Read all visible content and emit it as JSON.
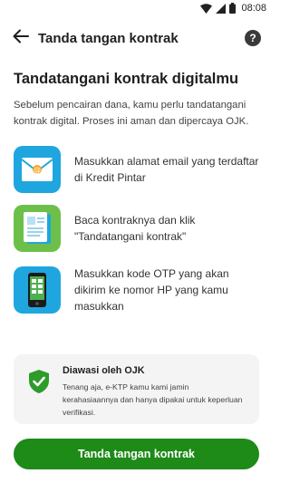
{
  "status_bar": {
    "time": "08:08"
  },
  "app_bar": {
    "title": "Tanda tangan kontrak",
    "help_label": "?"
  },
  "heading": "Tandatangani kontrak digitalmu",
  "intro": "Sebelum pencairan dana, kamu perlu tandatangani kontrak digital. Proses ini aman dan dipercaya OJK.",
  "steps": [
    {
      "icon": "email-envelope-icon",
      "text": "Masukkan alamat email yang terdaftar di Kredit Pintar"
    },
    {
      "icon": "document-icon",
      "text": "Baca kontraknya dan klik \"Tandatangani kontrak\""
    },
    {
      "icon": "phone-otp-icon",
      "text": "Masukkan kode OTP yang akan dikirim ke nomor HP yang kamu masukkan"
    }
  ],
  "ojk_card": {
    "title": "Diawasi oleh OJK",
    "description": "Tenang aja, e-KTP kamu kami jamin kerahasiaannya dan hanya dipakai untuk keperluan verifikasi."
  },
  "cta_label": "Tanda tangan kontrak",
  "colors": {
    "primary": "#1e8a18",
    "tile_blue": "#1fa6df",
    "tile_green": "#6cc04a",
    "card_bg": "#f4f4f4"
  }
}
